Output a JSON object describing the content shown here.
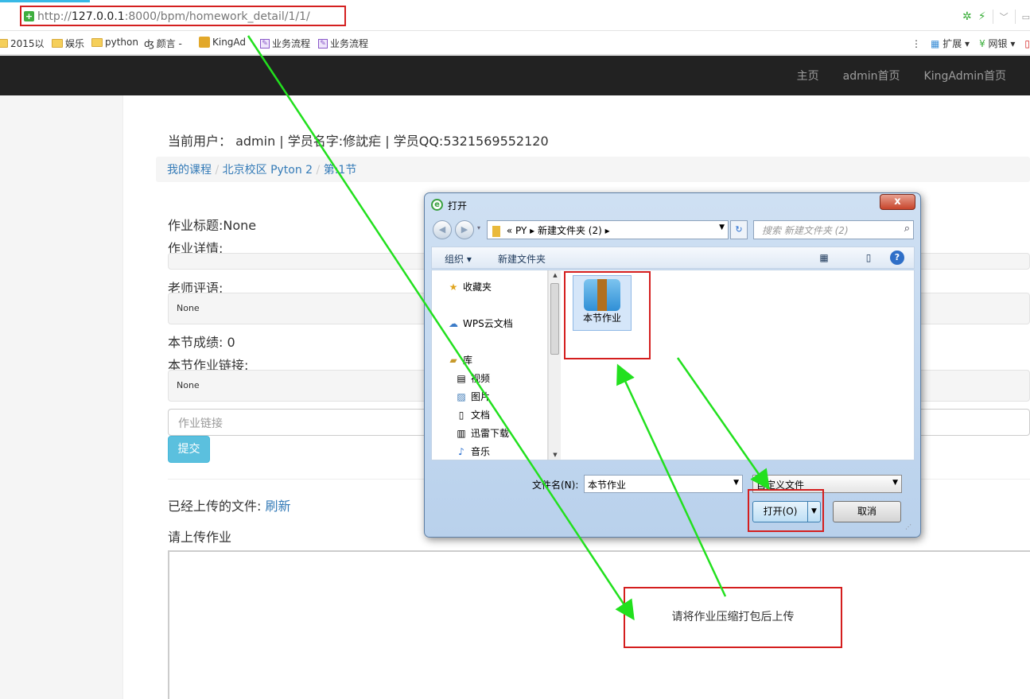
{
  "browser": {
    "url_prefix": "http://",
    "url_host": "127.0.0.1",
    "url_rest": ":8000/bpm/homework_detail/1/1/",
    "bookmarks": [
      "2015以",
      "娱乐",
      "python",
      "颜言 -",
      "KingAd",
      "业务流程",
      "业务流程"
    ],
    "ext_label": "扩展",
    "bank_label": "网银"
  },
  "nav": {
    "items": [
      "主页",
      "admin首页",
      "KingAdmin首页"
    ]
  },
  "page": {
    "user_info": "当前用户： admin | 学员名字:修訦疟 | 学员QQ:5321569552120",
    "breadcrumb": [
      "我的课程",
      "北京校区 Pyton 2",
      "第:1节"
    ],
    "homework_title": "作业标题:None",
    "homework_detail_label": "作业详情:",
    "teacher_comment_label": "老师评语:",
    "teacher_comment_value": "None",
    "score": "本节成绩: 0",
    "link_label": "本节作业链接:",
    "link_value": "None",
    "link_placeholder": "作业链接",
    "submit": "提交",
    "uploaded_files_label": "已经上传的文件:",
    "refresh": "刷新",
    "upload_prompt": "请上传作业"
  },
  "dialog": {
    "title": "打开",
    "close": "x",
    "path": [
      "«",
      "PY",
      "新建文件夹 (2)"
    ],
    "search_placeholder": "搜索 新建文件夹 (2)",
    "organize": "组织 ▾",
    "new_folder": "新建文件夹",
    "nav_items": [
      "收藏夹",
      "WPS云文档",
      "库",
      "视频",
      "图片",
      "文档",
      "迅雷下载",
      "音乐"
    ],
    "file_name": "本节作业",
    "file_name_label": "文件名(N):",
    "file_name_value": "本节作业",
    "file_type": "自定义文件",
    "open_button": "打开(O)",
    "cancel_button": "取消"
  },
  "annotation": {
    "note": "请将作业压缩打包后上传"
  },
  "colors": {
    "annotation_red": "#d41e1e",
    "arrow_green": "#22e01e",
    "navbar": "#222222",
    "link_blue": "#337ab7"
  }
}
